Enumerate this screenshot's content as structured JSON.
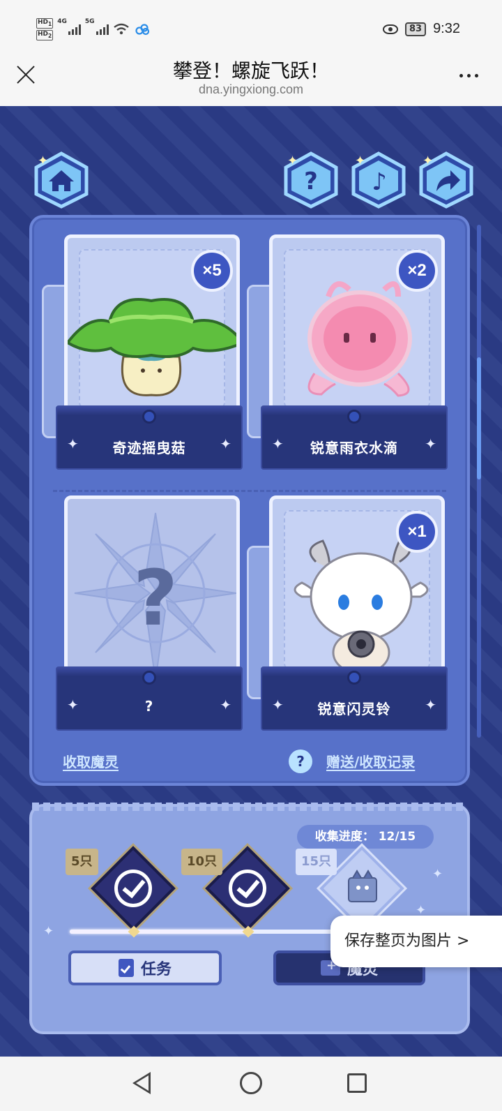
{
  "status_bar": {
    "hd1": "HD",
    "hd1_sub": "1",
    "hd2": "HD",
    "hd2_sub": "2",
    "net1": "4G",
    "net2": "5G",
    "battery": "83",
    "time": "9:32"
  },
  "browser": {
    "title": "攀登！螺旋飞跃！",
    "url": "dna.yingxiong.com"
  },
  "top_buttons": [
    {
      "icon": "home-icon"
    },
    {
      "icon": "help-icon",
      "glyph": "?"
    },
    {
      "icon": "music-icon",
      "glyph": "♪"
    },
    {
      "icon": "share-icon"
    }
  ],
  "cards": [
    {
      "name": "奇迹摇曳菇",
      "count": "×5",
      "art": "mushroom-creature"
    },
    {
      "name": "锐意雨衣水滴",
      "count": "×2",
      "art": "pink-raindrop-creature"
    },
    {
      "name": "?",
      "count": "",
      "art": "unknown-placeholder",
      "placeholder_glyph": "?"
    },
    {
      "name": "锐意闪灵铃",
      "count": "×1",
      "art": "white-goat-bell-creature"
    }
  ],
  "card_sparkle": "✦",
  "links": {
    "collect": "收取魔灵",
    "help_glyph": "?",
    "records": "赠送/收取记录"
  },
  "progress": {
    "label": "收集进度：",
    "value": "12/15",
    "milestones": [
      {
        "label": "5只",
        "claimed": true
      },
      {
        "label": "10只",
        "claimed": true
      },
      {
        "label": "15只",
        "claimed": false
      }
    ]
  },
  "buttons": {
    "task": "任务",
    "spirit": "魔灵"
  },
  "toast": "保存整页为图片 >",
  "colors": {
    "background": "#2b3c87",
    "panel": "#5771c9",
    "card_pocket": "#27357a",
    "accent_link": "#cfe6ff"
  }
}
